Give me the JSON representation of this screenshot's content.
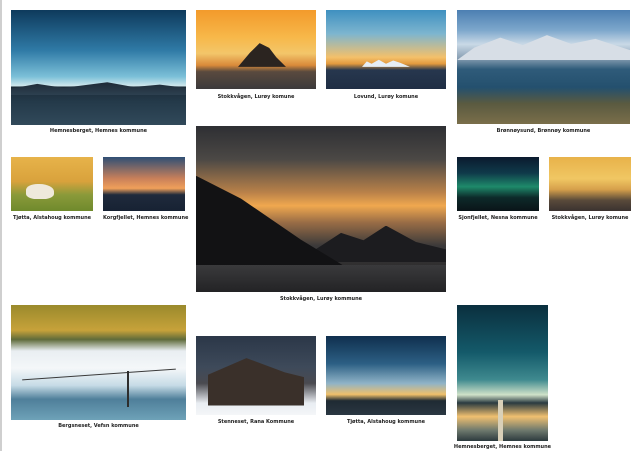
{
  "captions": {
    "c1": "Hemnesberget, Hemnes kommune",
    "c2": "Stokkvågen, Lurøy komune",
    "c3": "Lovund, Lurøy komune",
    "c4": "Brønnøysund, Brønnøy kommune",
    "c5": "Tjøtta, Alstahoug kommune",
    "c6": "Korgfjellet, Hemnes kommune",
    "c7": "Stokkvågen, Lurøy kommune",
    "c8": "Sjonfjellet, Nesna kommune",
    "c9": "Stokkvågen, Lurøy komune",
    "c10": "Bergsneset, Vefsn kommune",
    "c11": "Stenneset, Rana Kommune",
    "c12": "Tjøtta, Alstahoug kommune",
    "c13": "Hemnesberget, Hemnes kommune"
  }
}
